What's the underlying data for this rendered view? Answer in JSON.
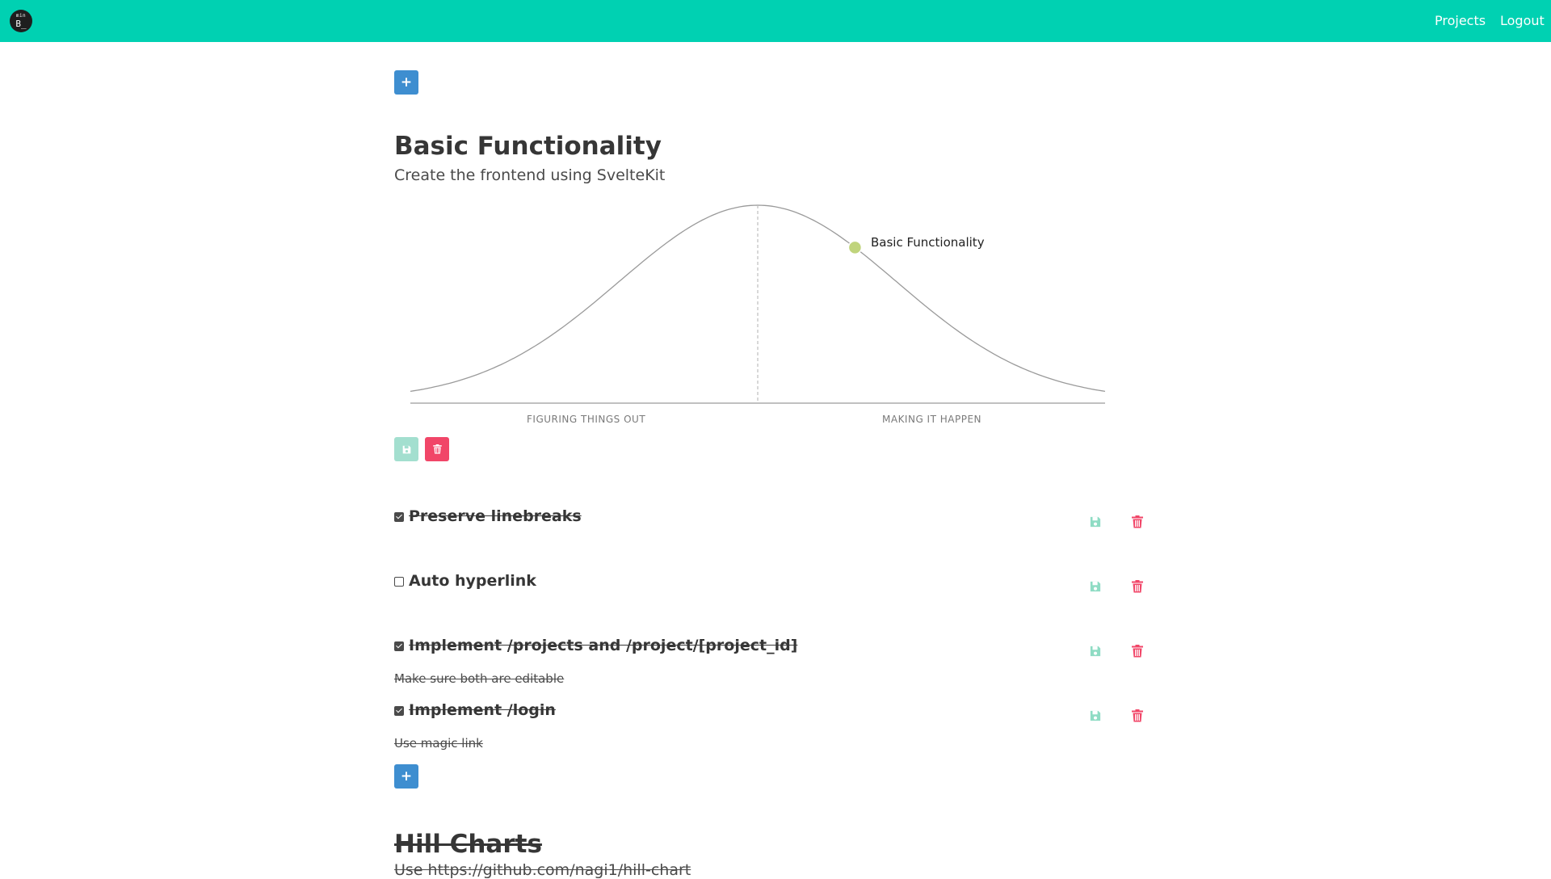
{
  "navbar": {
    "logo_top": "min",
    "logo_bottom": "B_",
    "projects_label": "Projects",
    "logout_label": "Logout",
    "color": "#00d1b2"
  },
  "add_label": "+",
  "project": {
    "title": "Basic Functionality",
    "subtitle": "Create the frontend using SvelteKit"
  },
  "hill_chart": {
    "left_label": "FIGURING THINGS OUT",
    "right_label": "MAKING IT HAPPEN",
    "points": [
      {
        "label": "Basic Functionality",
        "position_percent": 64,
        "color": "#c0d47c"
      }
    ]
  },
  "icons": {
    "save": "floppy-disk-icon",
    "delete": "trash-icon",
    "save_color": "#8fdcc4",
    "delete_color": "#f14668"
  },
  "tasks": [
    {
      "title": "Preserve linebreaks",
      "done": true,
      "description": ""
    },
    {
      "title": "Auto hyperlink",
      "done": false,
      "description": ""
    },
    {
      "title": "Implement /projects and /project/[project_id]",
      "done": true,
      "description": "Make sure both are editable"
    },
    {
      "title": "Implement /login",
      "done": true,
      "description": "Use magic link"
    }
  ],
  "next_section": {
    "title": "Hill Charts",
    "subtitle": "Use https://github.com/nagi1/hill-chart"
  }
}
